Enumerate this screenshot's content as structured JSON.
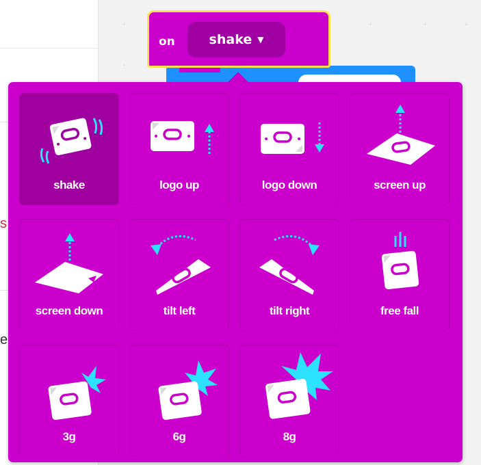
{
  "hat_block": {
    "prefix": "on",
    "selected_gesture": "shake",
    "caret": "▼"
  },
  "gestures": [
    {
      "label": "shake",
      "icon": "shake-icon",
      "selected": true
    },
    {
      "label": "logo up",
      "icon": "logo-up-icon",
      "selected": false
    },
    {
      "label": "logo down",
      "icon": "logo-down-icon",
      "selected": false
    },
    {
      "label": "screen up",
      "icon": "screen-up-icon",
      "selected": false
    },
    {
      "label": "screen down",
      "icon": "screen-down-icon",
      "selected": false
    },
    {
      "label": "tilt left",
      "icon": "tilt-left-icon",
      "selected": false
    },
    {
      "label": "tilt right",
      "icon": "tilt-right-icon",
      "selected": false
    },
    {
      "label": "free fall",
      "icon": "free-fall-icon",
      "selected": false
    },
    {
      "label": "3g",
      "icon": "3g-icon",
      "selected": false
    },
    {
      "label": "6g",
      "icon": "6g-icon",
      "selected": false
    },
    {
      "label": "8g",
      "icon": "8g-icon",
      "selected": false
    }
  ],
  "colors": {
    "block_magenta": "#cc00cc",
    "selected_tile": "#a000a0",
    "hat_outline": "#ffe14d",
    "accent_cyan": "#2de2ff",
    "inner_block_blue": "#1e90ff"
  },
  "left_panel": {
    "peek_letter_red": "s",
    "peek_letter_dark": "e"
  }
}
